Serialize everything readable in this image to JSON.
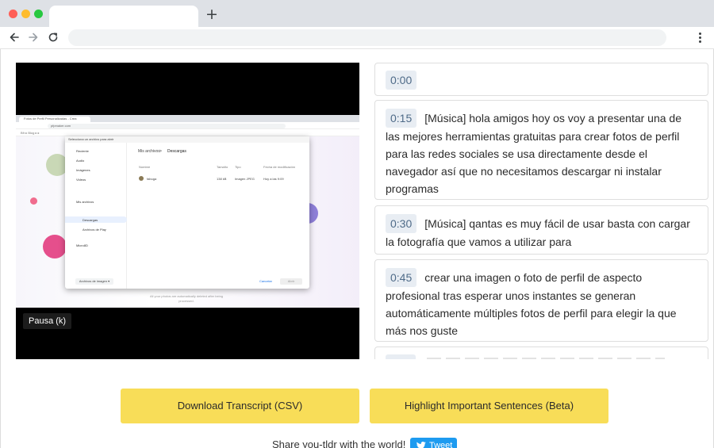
{
  "browser": {
    "tab_title": "",
    "new_tab_label": "+",
    "url": ""
  },
  "video": {
    "pause_label": "Pausa (k)",
    "frame": {
      "tab": "Fotos de Perfil Personalizadas - Crea",
      "url": "pfpmaker.com",
      "bookmarks": "Bfr ▸ Blog ▸ ▸",
      "dialog_title": "Selecciona un archivo para abrir",
      "sidebar": [
        "Reciente",
        "Audio",
        "Imágenes",
        "Videos",
        "Mis archivos",
        "Descargas",
        "Archivos de Play",
        "Micro8D"
      ],
      "path": [
        "Mis archivos",
        ">",
        "Descargas"
      ],
      "columns": [
        "Nombre",
        "Tamaño",
        "Tipo",
        "Fecha de modificación"
      ],
      "file": {
        "name": "fabuga",
        "size": "138 kB",
        "type": "Imagen JPEG",
        "date": "Hoy a las 9:09"
      },
      "filter": "Archivos de imagen ▾",
      "cancel": "Cancelar",
      "open": "Abrir",
      "footer": "All your photos are automatically deleted after being processed."
    }
  },
  "transcript": [
    {
      "time": "0:00",
      "text": ""
    },
    {
      "time": "0:15",
      "text": "[Música] hola amigos hoy os voy a presentar una de las mejores herramientas gratuitas para crear fotos de perfil para las redes sociales se usa directamente desde el navegador así que no necesitamos descargar ni instalar programas"
    },
    {
      "time": "0:30",
      "text": "[Música] qantas es muy fácil de usar basta con cargar la fotografía que vamos a utilizar para"
    },
    {
      "time": "0:45",
      "text": "crear una imagen o foto de perfil de aspecto profesional tras esperar unos instantes se generan automáticamente múltiples fotos de perfil para elegir la que más nos guste"
    }
  ],
  "actions": {
    "download_label": "Download Transcript (CSV)",
    "highlight_label": "Highlight Important Sentences (Beta)"
  },
  "share": {
    "text": "Share you-tldr with the world!",
    "tweet_label": "Tweet"
  },
  "colors": {
    "button_yellow": "#f8dd58",
    "timestamp_bg": "#e8edf3",
    "timestamp_text": "#4f6b88",
    "tweet_blue": "#1d9bf0"
  },
  "icons": [
    "back-arrow-icon",
    "forward-arrow-icon",
    "reload-icon",
    "more-vert-icon",
    "twitter-bird-icon"
  ]
}
